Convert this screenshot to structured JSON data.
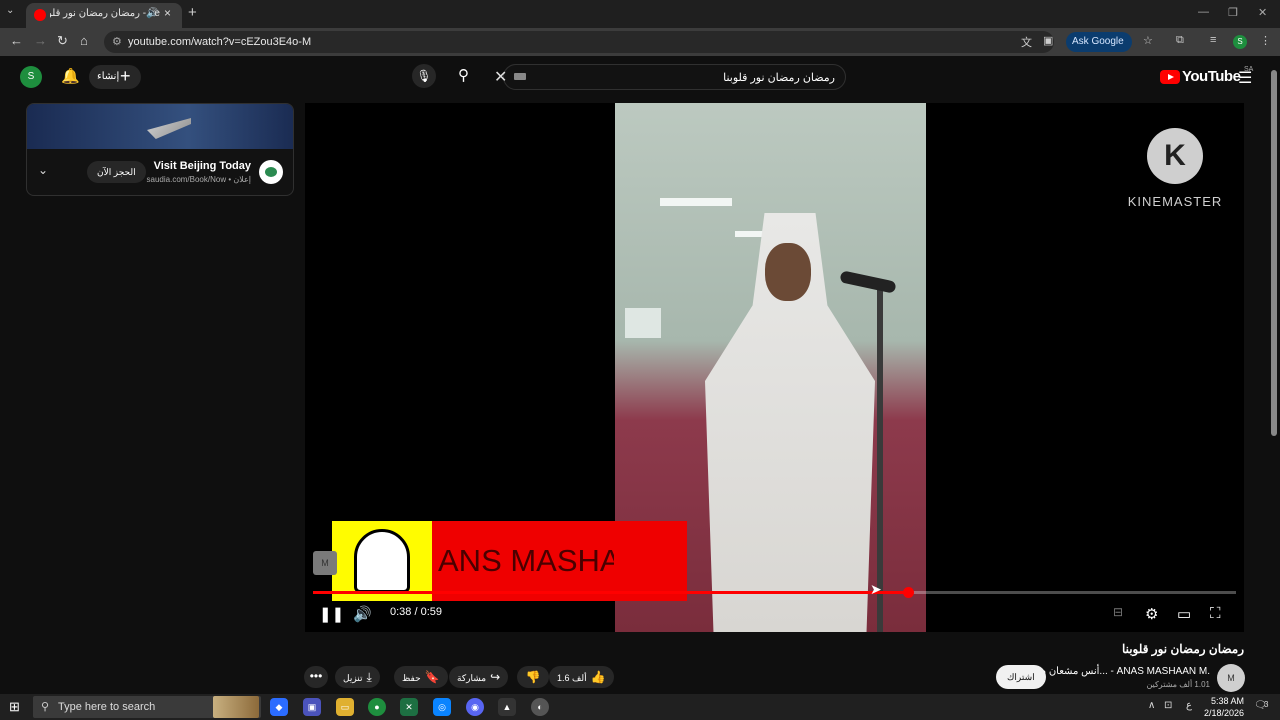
{
  "browser": {
    "tab_title": "be - رمضان رمضان نور قلوبنا",
    "new_tab": "+",
    "url": "youtube.com/watch?v=cEZou3E4o-M",
    "ask_google": "Ask Google",
    "profile_letter": "S"
  },
  "youtube": {
    "logo_text": "YouTube",
    "country_code": "SA",
    "search_query": "رمضان رمضان نور قلوبنا",
    "create_label": "إنشاء",
    "avatar_letter": "S"
  },
  "ad": {
    "headline": "Visit Beijing Today",
    "sponsor": "إعلان • saudia.com/Book/Now",
    "cta": "الحجز الآن"
  },
  "player": {
    "overlay_brand": "KINEMASTER",
    "overlay_brand_letter": "K",
    "snap_banner_text": "ANS MASHA",
    "time": "0:38 / 0:59",
    "progress": 0.645,
    "state": "playing",
    "watermark": "M"
  },
  "video": {
    "title": "رمضان رمضان نور قلوبنا",
    "channel": "أنس مشعان م... - ANAS MASHAAN M.",
    "subscribers": "1.01 ألف مشتركين",
    "subscribe_label": "اشتراك",
    "likes": "1.6 ألف",
    "share_label": "مشاركة",
    "save_label": "حفظ",
    "download_label": "تنزيل",
    "more_label": "•••"
  },
  "taskbar": {
    "search_placeholder": "Type here to search",
    "time": "5:38 AM",
    "date": "2/18/2026",
    "lang": "ع",
    "notifications": "3"
  },
  "colors": {
    "accent": "#ff0000",
    "background": "#0f0f0f",
    "snap_yellow": "#fffc00"
  }
}
